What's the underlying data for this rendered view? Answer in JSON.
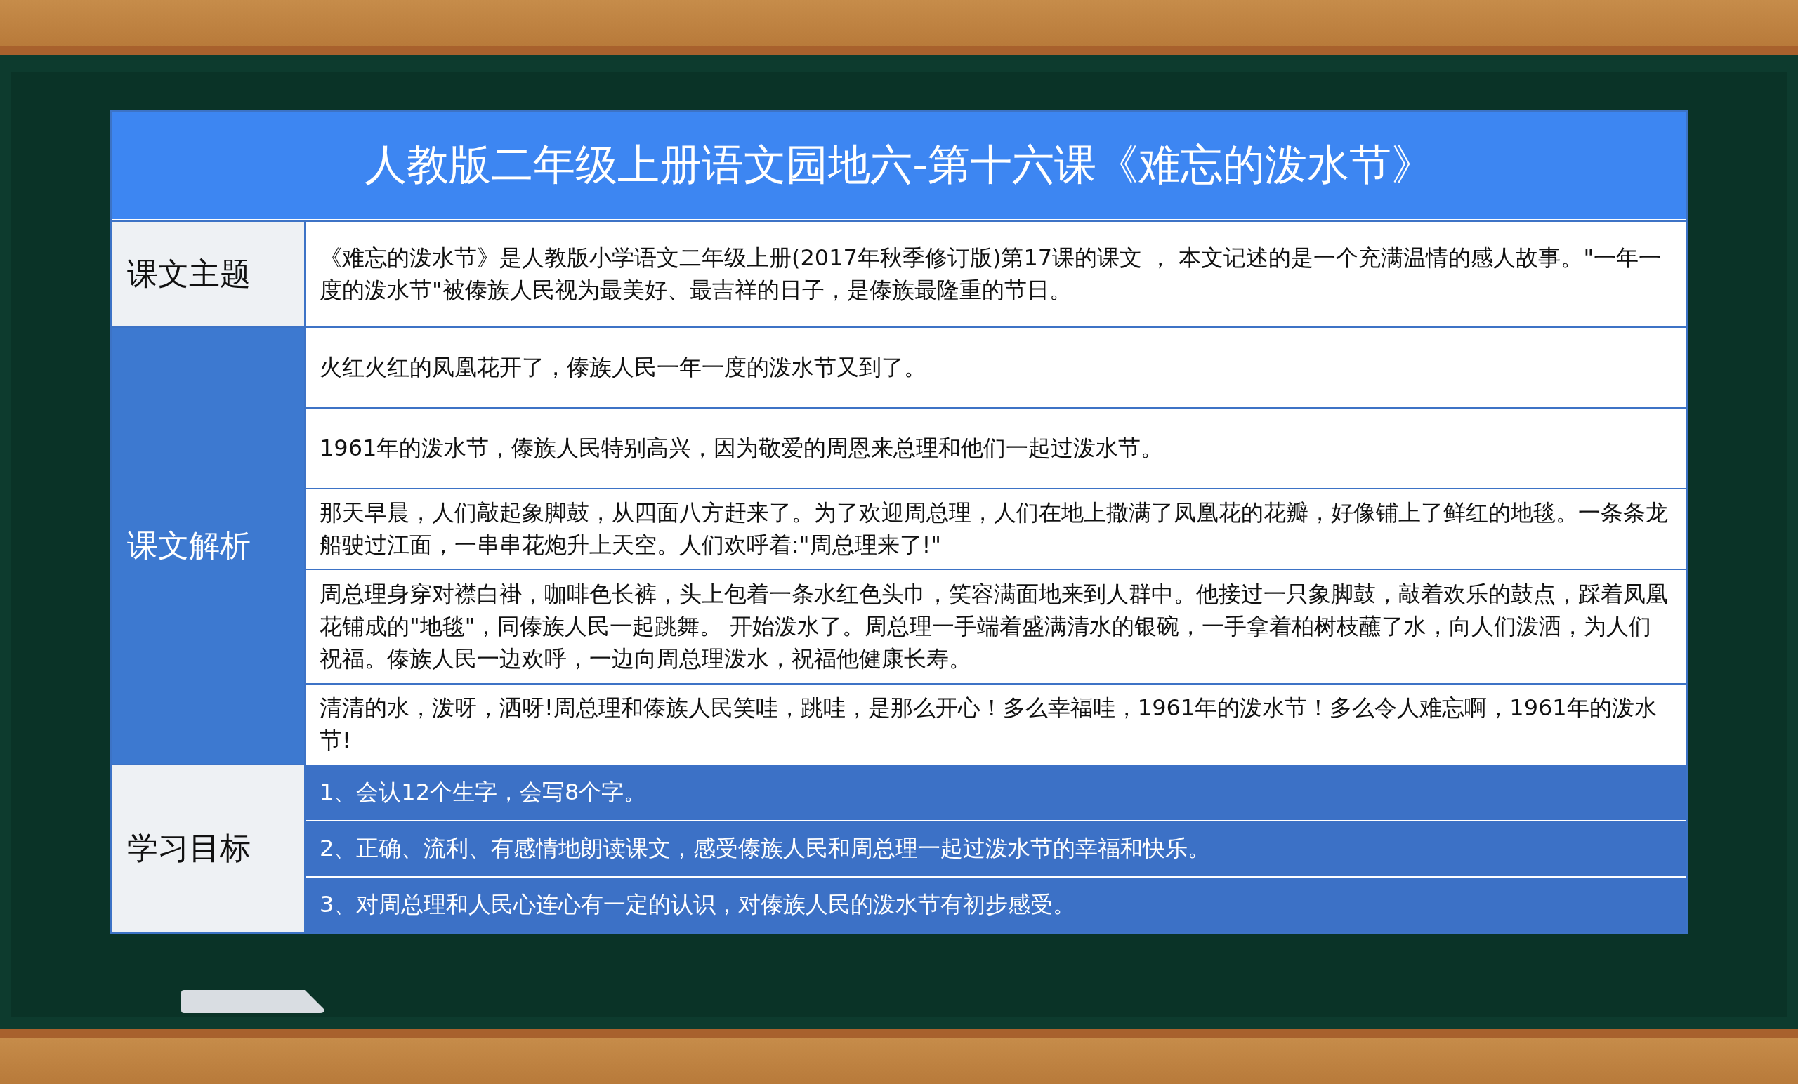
{
  "title": "人教版二年级上册语文园地六-第十六课《难忘的泼水节》",
  "sections": [
    {
      "kind": "theme",
      "label": "课文主题",
      "items": [
        "《难忘的泼水节》是人教版小学语文二年级上册(2017年秋季修订版)第17课的课文 ， 本文记述的是一个充满温情的感人故事。\"一年一度的泼水节\"被傣族人民视为最美好、最吉祥的日子，是傣族最隆重的节日。"
      ]
    },
    {
      "kind": "analysis",
      "label": "课文解析",
      "items": [
        "火红火红的凤凰花开了，傣族人民一年一度的泼水节又到了。",
        "1961年的泼水节，傣族人民特别高兴，因为敬爱的周恩来总理和他们一起过泼水节。",
        "那天早晨，人们敲起象脚鼓，从四面八方赶来了。为了欢迎周总理，人们在地上撒满了凤凰花的花瓣，好像铺上了鲜红的地毯。一条条龙船驶过江面，一串串花炮升上天空。人们欢呼着:\"周总理来了!\"",
        "周总理身穿对襟白褂，咖啡色长裤，头上包着一条水红色头巾，笑容满面地来到人群中。他接过一只象脚鼓，敲着欢乐的鼓点，踩着凤凰花铺成的\"地毯\"，同傣族人民一起跳舞。 开始泼水了。周总理一手端着盛满清水的银碗，一手拿着柏树枝蘸了水，向人们泼洒，为人们祝福。傣族人民一边欢呼，一边向周总理泼水，祝福他健康长寿。",
        "清清的水，泼呀，洒呀!周总理和傣族人民笑哇，跳哇，是那么开心！多么幸福哇，1961年的泼水节！多么令人难忘啊，1961年的泼水节!"
      ]
    },
    {
      "kind": "goals",
      "label": "学习目标",
      "items": [
        "1、会认12个生字，会写8个字。",
        "2、正确、流利、有感情地朗读课文，感受傣族人民和周总理一起过泼水节的幸福和快乐。",
        "3、对周总理和人民心连心有一定的认识，对傣族人民的泼水节有初步感受。"
      ]
    }
  ]
}
